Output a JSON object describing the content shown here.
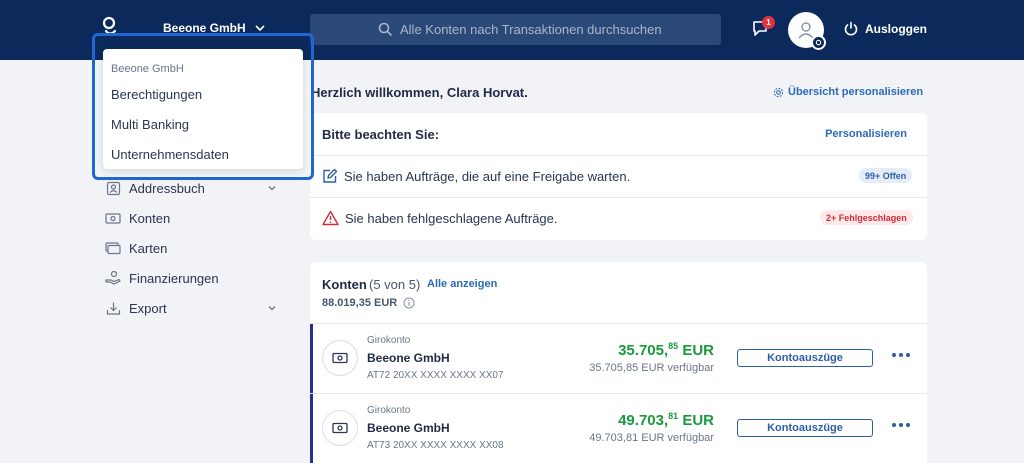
{
  "header": {
    "company": "Beeone GmbH",
    "search_placeholder": "Alle Konten nach Transaktionen durchsuchen",
    "chat_badge": "1",
    "logout": "Ausloggen"
  },
  "dropdown": {
    "header": "Beeone GmbH",
    "items": [
      "Berechtigungen",
      "Multi Banking",
      "Unternehmensdaten"
    ]
  },
  "sidebar": {
    "items": [
      {
        "label": "Addressbuch",
        "icon": "contact-book-icon"
      },
      {
        "label": "Konten",
        "icon": "banknote-icon"
      },
      {
        "label": "Karten",
        "icon": "cards-icon"
      },
      {
        "label": "Finanzierungen",
        "icon": "hand-money-icon"
      },
      {
        "label": "Export",
        "icon": "download-icon"
      }
    ]
  },
  "main": {
    "welcome": "Herzlich willkommen, Clara Horvat.",
    "personalize_overview": "Übersicht personalisieren",
    "notice": {
      "title": "Bitte beachten Sie:",
      "personalize": "Personalisieren",
      "rows": [
        {
          "text": "Sie haben Aufträge, die auf eine Freigabe warten.",
          "pill": "99+ Offen"
        },
        {
          "text": "Sie haben fehlgeschlagene Aufträge.",
          "pill": "2+ Fehlgeschlagen"
        }
      ]
    },
    "accounts": {
      "title": "Konten",
      "count": "(5 von 5)",
      "show_all": "Alle anzeigen",
      "total": "88.019,35 EUR",
      "rows": [
        {
          "type": "Girokonto",
          "name": "Beeone GmbH",
          "iban": "AT72 20XX XXXX XXXX XX07",
          "amount_main": "35.705,",
          "amount_cents": "85",
          "amount_currency": " EUR",
          "available": "35.705,85 EUR verfügbar",
          "button": "Kontoauszüge"
        },
        {
          "type": "Girokonto",
          "name": "Beeone GmbH",
          "iban": "AT73 20XX XXXX XXXX XX08",
          "amount_main": "49.703,",
          "amount_cents": "81",
          "amount_currency": " EUR",
          "available": "49.703,81 EUR verfügbar",
          "button": "Kontoauszüge"
        }
      ]
    }
  },
  "colors": {
    "header_bg": "#0b2a5b",
    "accent": "#2d6ab8",
    "amount_green": "#1a9a3c",
    "alert_red": "#e0333f",
    "dropdown_outline": "#2167d1"
  }
}
